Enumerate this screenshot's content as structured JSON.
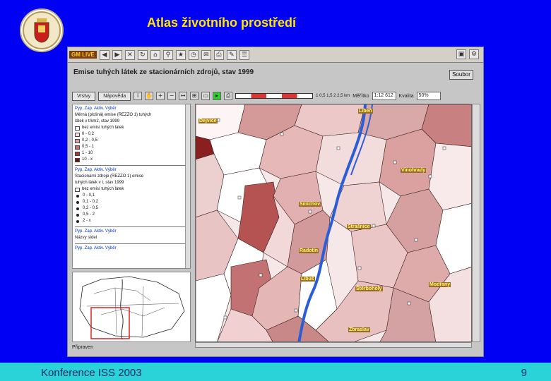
{
  "slide": {
    "title": "Atlas životního prostředí",
    "footer_left": "Konference ISS 2003",
    "page_number": "9"
  },
  "app": {
    "brand": "GM LIVE",
    "map_title": "Emise tuhých látek ze stacionárních zdrojů, stav 1999",
    "soubor_button": "Soubor",
    "tabs": [
      "Vrstvy",
      "Nápověda"
    ],
    "scale_ticks": [
      "1",
      "0,5",
      "1,5",
      "2",
      "2,5 km"
    ],
    "meritko_label": "Měřítko",
    "meritko_value": "1:12 612",
    "kvalita_label": "Kvalita",
    "kvalita_value": "50%",
    "status_text": "Připraven"
  },
  "legend": {
    "section1": {
      "links": "Pyp. Zap. Aktiv. Výběr",
      "title_lines": [
        "Měrná (plošná) emise (REZZO 1) tuhých",
        "látek v t/km2, stav 1999"
      ],
      "items": [
        {
          "label": "bez emisí tuhých látek",
          "color": "#ffffff"
        },
        {
          "label": "0 - 0,2",
          "color": "#f4dede"
        },
        {
          "label": "0,2 - 0,5",
          "color": "#d9a3a3"
        },
        {
          "label": "0,5 - 1",
          "color": "#c07070"
        },
        {
          "label": "1 - 10",
          "color": "#9e3f3f"
        },
        {
          "label": "10 - x",
          "color": "#6b1414"
        }
      ]
    },
    "section2": {
      "links": "Pyp. Zap. Aktiv. Výběr",
      "title_lines": [
        "Stacionární zdroje (REZZO 1) emise",
        "tuhých látek v t, stav 1999"
      ],
      "items": [
        {
          "label": "bez emisí tuhých látek"
        },
        {
          "label": "0 - 0,1"
        },
        {
          "label": "0,1 - 0,2"
        },
        {
          "label": "0,2 - 0,5"
        },
        {
          "label": "0,5 - 2"
        },
        {
          "label": "2 - x"
        }
      ]
    },
    "section3": {
      "links": "Pyp. Zap. Aktiv. Výběr",
      "title": "Názvy sídel"
    },
    "section4": {
      "links": "Pyp. Zap. Aktiv. Výběr"
    }
  },
  "map_labels": [
    "Dejvice",
    "Libeň",
    "Smíchov",
    "Vinohrady",
    "Strašnice",
    "Radotín",
    "Libuš",
    "Zbraslav",
    "Modřany",
    "Štěrboholy"
  ],
  "colors": {
    "slide_bg": "#0000f5",
    "title": "#ffe600",
    "footer_bg": "#2ad3d8",
    "footer_text": "#0a2a6a"
  }
}
